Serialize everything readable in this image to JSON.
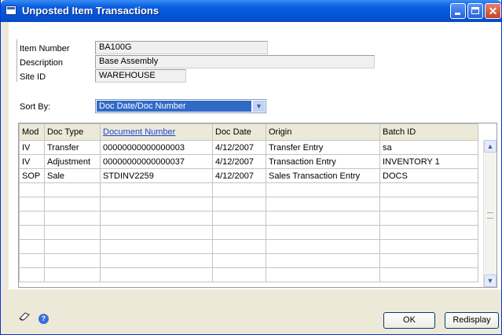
{
  "window": {
    "title": "Unposted Item Transactions"
  },
  "fields": {
    "item_number": {
      "label": "Item Number",
      "value": "BA100G"
    },
    "description": {
      "label": "Description",
      "value": "Base Assembly"
    },
    "site_id": {
      "label": "Site ID",
      "value": "WAREHOUSE"
    },
    "sort_by": {
      "label": "Sort By:",
      "value": "Doc Date/Doc Number"
    }
  },
  "table": {
    "columns": [
      "Mod",
      "Doc Type",
      "Document Number",
      "Doc Date",
      "Origin",
      "Batch ID"
    ],
    "rows": [
      [
        "IV",
        "Transfer",
        "00000000000000003",
        "4/12/2007",
        "Transfer Entry",
        "sa"
      ],
      [
        "IV",
        "Adjustment",
        "00000000000000037",
        "4/12/2007",
        "Transaction Entry",
        "INVENTORY 1"
      ],
      [
        "SOP",
        "Sale",
        "STDINV2259",
        "4/12/2007",
        "Sales Transaction Entry",
        "DOCS"
      ]
    ]
  },
  "buttons": {
    "ok": "OK",
    "redisplay": "Redisplay"
  },
  "icons": {
    "note": "note-icon",
    "help": "help-icon"
  }
}
